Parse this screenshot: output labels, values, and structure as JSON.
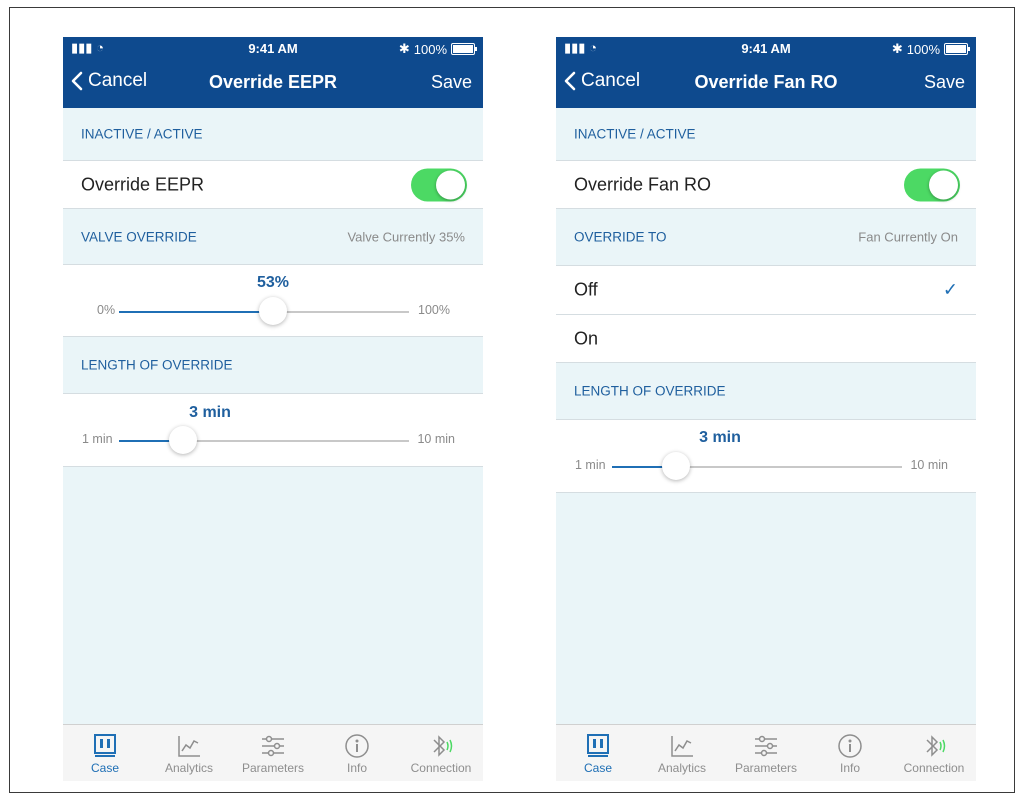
{
  "status": {
    "time": "9:41 AM",
    "signal": "▮▮▮",
    "wifi": "◔",
    "bluetooth": "✱",
    "battery": "100%"
  },
  "tabs": [
    "Case",
    "Analytics",
    "Parameters",
    "Info",
    "Connection"
  ],
  "left": {
    "nav": {
      "cancel": "Cancel",
      "title": "Override EEPR",
      "save": "Save"
    },
    "section1": {
      "header": "INACTIVE / ACTIVE",
      "row_label": "Override EEPR",
      "toggle_on": true
    },
    "section2": {
      "header": "VALVE OVERRIDE",
      "status": "Valve Currently 35%"
    },
    "valve_slider": {
      "value": "53%",
      "min": "0%",
      "max": "100%",
      "fraction": 0.53
    },
    "section3": {
      "header": "LENGTH OF OVERRIDE"
    },
    "length_slider": {
      "value": "3 min",
      "min": "1 min",
      "max": "10 min",
      "fraction": 0.22
    }
  },
  "right": {
    "nav": {
      "cancel": "Cancel",
      "title": "Override Fan RO",
      "save": "Save"
    },
    "section1": {
      "header": "INACTIVE / ACTIVE",
      "row_label": "Override Fan RO",
      "toggle_on": true
    },
    "section2": {
      "header": "OVERRIDE TO",
      "status": "Fan Currently On"
    },
    "options": [
      {
        "label": "Off",
        "selected": true
      },
      {
        "label": "On",
        "selected": false
      }
    ],
    "check": "✓",
    "section3": {
      "header": "LENGTH OF OVERRIDE"
    },
    "length_slider": {
      "value": "3 min",
      "min": "1 min",
      "max": "10 min",
      "fraction": 0.22
    }
  }
}
